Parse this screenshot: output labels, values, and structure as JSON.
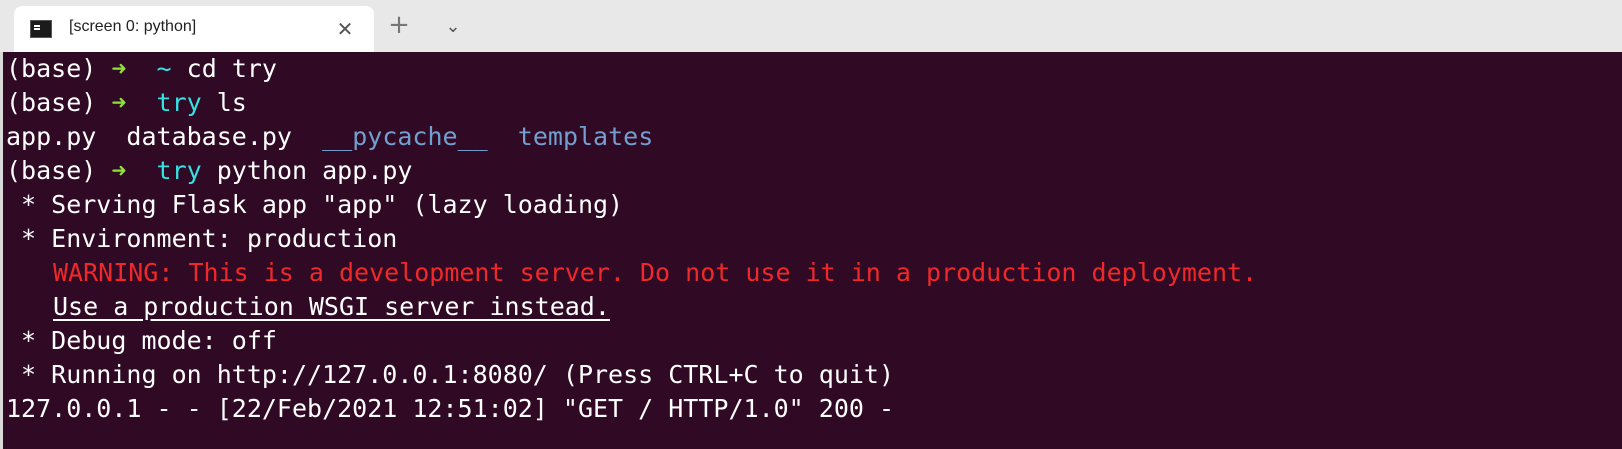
{
  "tab": {
    "title": "[screen 0: python]",
    "close_glyph": "✕",
    "new_tab_glyph": "+",
    "dropdown_glyph": "⌄"
  },
  "terminal": {
    "prompt_env": "(base)",
    "prompt_arrow": "➜",
    "lines": [
      {
        "dir": "~",
        "cmd": " cd try"
      },
      {
        "dir": "try",
        "cmd": " ls"
      },
      {
        "files": [
          "app.py",
          "database.py",
          "__pycache__",
          "templates"
        ]
      },
      {
        "dir": "try",
        "cmd": " python app.py"
      },
      {
        "text": " * Serving Flask app \"app\" (lazy loading)"
      },
      {
        "text": " * Environment: production"
      },
      {
        "warning": "WARNING: This is a development server. Do not use it in a production deployment."
      },
      {
        "text": "Use a production WSGI server instead."
      },
      {
        "text": " * Debug mode: off"
      },
      {
        "text": " * Running on http://127.0.0.1:8080/ (Press CTRL+C to quit)"
      },
      {
        "text": "127.0.0.1 - - [22/Feb/2021 12:51:02] \"GET / HTTP/1.0\" 200 -"
      }
    ]
  },
  "colors": {
    "terminal_bg": "#300a24",
    "prompt_arrow": "#8ae234",
    "directory": "#34e2e2",
    "folder": "#729fcf",
    "warning": "#ef2929"
  }
}
